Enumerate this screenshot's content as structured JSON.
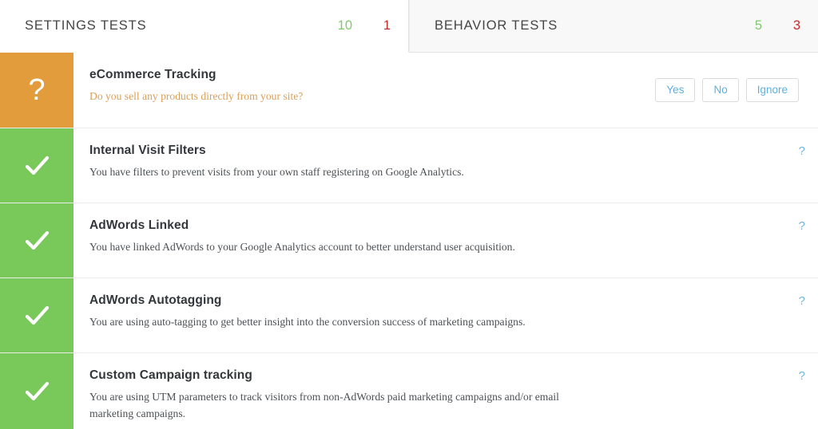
{
  "tabs": [
    {
      "id": "settings-tests",
      "label": "SETTINGS TESTS",
      "pass_count": "10",
      "fail_count": "1",
      "active": true,
      "pass_color": "#7fc96c",
      "fail_color": "#c32b2b"
    },
    {
      "id": "behavior-tests",
      "label": "BEHAVIOR TESTS",
      "pass_count": "5",
      "fail_count": "3",
      "active": false,
      "pass_color": "#7fc96c",
      "fail_color": "#c32b2b"
    }
  ],
  "colors": {
    "warn": "#e39c3c",
    "pass": "#78c85a",
    "link": "#5ab0e0",
    "question_text": "#d9a05b"
  },
  "tests": [
    {
      "status": "question",
      "status_icon": "question-mark-icon",
      "icon_glyph": "?",
      "title": "eCommerce Tracking",
      "description": "Do you sell any products directly from your site?",
      "actions": [
        {
          "id": "yes",
          "label": "Yes"
        },
        {
          "id": "no",
          "label": "No"
        },
        {
          "id": "ignore",
          "label": "Ignore"
        }
      ],
      "help_label": "?"
    },
    {
      "status": "pass",
      "status_icon": "check-mark-icon",
      "title": "Internal Visit Filters",
      "description": "You have filters to prevent visits from your own staff registering on Google Analytics.",
      "actions": [],
      "help_label": "?"
    },
    {
      "status": "pass",
      "status_icon": "check-mark-icon",
      "title": "AdWords Linked",
      "description": "You have linked AdWords to your Google Analytics account to better understand user acquisition.",
      "actions": [],
      "help_label": "?"
    },
    {
      "status": "pass",
      "status_icon": "check-mark-icon",
      "title": "AdWords Autotagging",
      "description": "You are using auto-tagging to get better insight into the conversion success of marketing campaigns.",
      "actions": [],
      "help_label": "?"
    },
    {
      "status": "pass",
      "status_icon": "check-mark-icon",
      "title": "Custom Campaign tracking",
      "description": "You are using UTM parameters to track visitors from non-AdWords paid marketing campaigns and/or email marketing campaigns.",
      "actions": [],
      "help_label": "?"
    }
  ]
}
